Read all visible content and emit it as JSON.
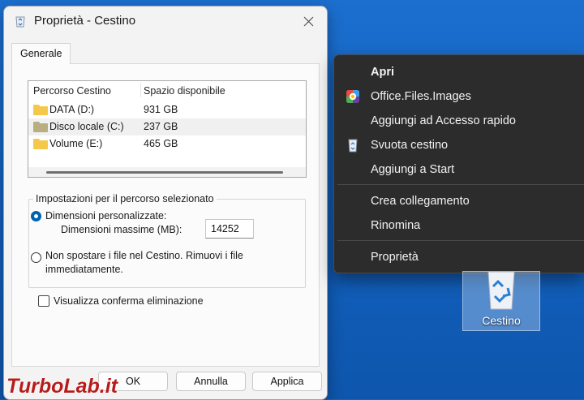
{
  "dialog": {
    "title": "Proprietà - Cestino",
    "tab_label": "Generale",
    "list": {
      "headers": [
        "Percorso Cestino",
        "Spazio disponibile"
      ],
      "rows": [
        {
          "name": "DATA (D:)",
          "space": "931 GB",
          "folder_color": "#f6c84a"
        },
        {
          "name": "Disco locale (C:)",
          "space": "237 GB",
          "folder_color": "#b8ae82"
        },
        {
          "name": "Volume (E:)",
          "space": "465 GB",
          "folder_color": "#f6c84a"
        }
      ],
      "selected_index": 1
    },
    "group_title": "Impostazioni per il percorso selezionato",
    "option_custom": "Dimensioni personalizzate:",
    "max_size_label": "Dimensioni massime (MB):",
    "max_size_value": "14252",
    "option_no_move_line1": "Non spostare i file nel Cestino. Rimuovi i file",
    "option_no_move_line2": "immediatamente.",
    "confirm_label": "Visualizza conferma eliminazione",
    "confirm_checked": false,
    "selected_option": "custom",
    "buttons": {
      "ok": "OK",
      "cancel": "Annulla",
      "apply": "Applica"
    }
  },
  "context_menu": {
    "items": [
      {
        "label": "Apri",
        "bold": true,
        "icon": null
      },
      {
        "label": "Office.Files.Images",
        "bold": false,
        "icon": "office-files-images-icon"
      },
      {
        "label": "Aggiungi ad Accesso rapido",
        "bold": false,
        "icon": null
      },
      {
        "label": "Svuota cestino",
        "bold": false,
        "icon": "recycle-bin-icon"
      },
      {
        "label": "Aggiungi a Start",
        "bold": false,
        "icon": null
      },
      {
        "label": "Crea collegamento",
        "bold": false,
        "icon": null
      },
      {
        "label": "Rinomina",
        "bold": false,
        "icon": null
      },
      {
        "label": "Proprietà",
        "bold": false,
        "icon": null
      }
    ]
  },
  "desktop": {
    "icon_label": "Cestino"
  },
  "watermark": {
    "text": "TurboLab.it"
  },
  "colors": {
    "desktop": "#1565c6",
    "accent": "#0063b1",
    "menu_bg": "#2c2c2c",
    "watermark": "#b71c1c"
  }
}
